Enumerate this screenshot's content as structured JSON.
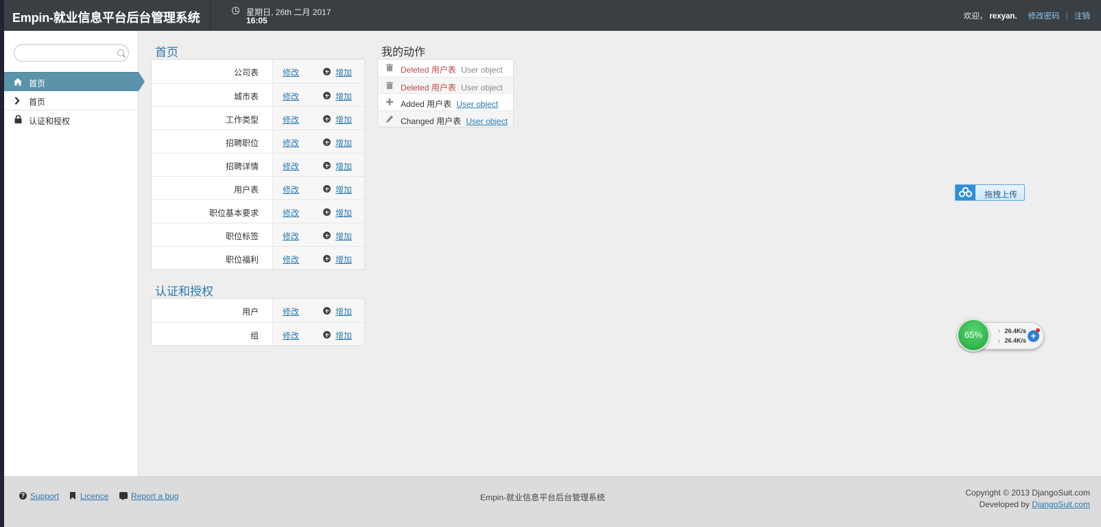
{
  "header": {
    "brand": "Empin-就业信息平台后台管理系统",
    "date": "星期日, 26th 二月 2017",
    "time": "16:05",
    "welcome": "欢迎，",
    "username": "rexyan.",
    "change_password": "修改密码",
    "separator": "|",
    "logout": "注销"
  },
  "sidebar": {
    "search_placeholder": "",
    "items": [
      {
        "label": "首页",
        "icon": "home-icon",
        "active": true
      },
      {
        "label": "首页",
        "icon": "chevron-right-icon",
        "active": false
      },
      {
        "label": "认证和授权",
        "icon": "lock-icon",
        "active": false
      }
    ]
  },
  "modules": [
    {
      "title": "首页",
      "rows": [
        {
          "name": "公司表",
          "change": "修改",
          "add": "增加"
        },
        {
          "name": "城市表",
          "change": "修改",
          "add": "增加"
        },
        {
          "name": "工作类型",
          "change": "修改",
          "add": "增加"
        },
        {
          "name": "招聘职位",
          "change": "修改",
          "add": "增加"
        },
        {
          "name": "招聘详情",
          "change": "修改",
          "add": "增加"
        },
        {
          "name": "用户表",
          "change": "修改",
          "add": "增加"
        },
        {
          "name": "职位基本要求",
          "change": "修改",
          "add": "增加"
        },
        {
          "name": "职位标签",
          "change": "修改",
          "add": "增加"
        },
        {
          "name": "职位福利",
          "change": "修改",
          "add": "增加"
        }
      ]
    },
    {
      "title": "认证和授权",
      "rows": [
        {
          "name": "用户",
          "change": "修改",
          "add": "增加"
        },
        {
          "name": "组",
          "change": "修改",
          "add": "增加"
        }
      ]
    }
  ],
  "actions": {
    "title": "我的动作",
    "items": [
      {
        "type": "deleted",
        "icon": "trash-icon",
        "verb": "Deleted",
        "model": "用户表",
        "object": "User object",
        "linked": false
      },
      {
        "type": "deleted",
        "icon": "trash-icon",
        "verb": "Deleted",
        "model": "用户表",
        "object": "User object",
        "linked": false
      },
      {
        "type": "added",
        "icon": "plus-icon",
        "verb": "Added",
        "model": "用户表",
        "object": "User object",
        "linked": true
      },
      {
        "type": "changed",
        "icon": "pencil-icon",
        "verb": "Changed",
        "model": "用户表",
        "object": "User object",
        "linked": true
      }
    ]
  },
  "upload_widget": {
    "label": "拖拽上传",
    "icon": "cloud-upload-icon"
  },
  "speed_widget": {
    "percent": "65%",
    "up": "26.4K/s",
    "down": "26.4K/s",
    "plus": "+"
  },
  "footer": {
    "support": "Support",
    "licence": "Licence",
    "report_bug": "Report a bug",
    "center": "Empin-就业信息平台后台管理系统",
    "copyright": "Copyright © 2013 DjangoSuit.com",
    "developed_by": "Developed by",
    "developed_link": "DjangoSuit.com"
  },
  "colors": {
    "header_bg": "#393f43",
    "sidebar_active": "#5b93ab",
    "link": "#2a7ab0",
    "deleted": "#b94a48"
  }
}
